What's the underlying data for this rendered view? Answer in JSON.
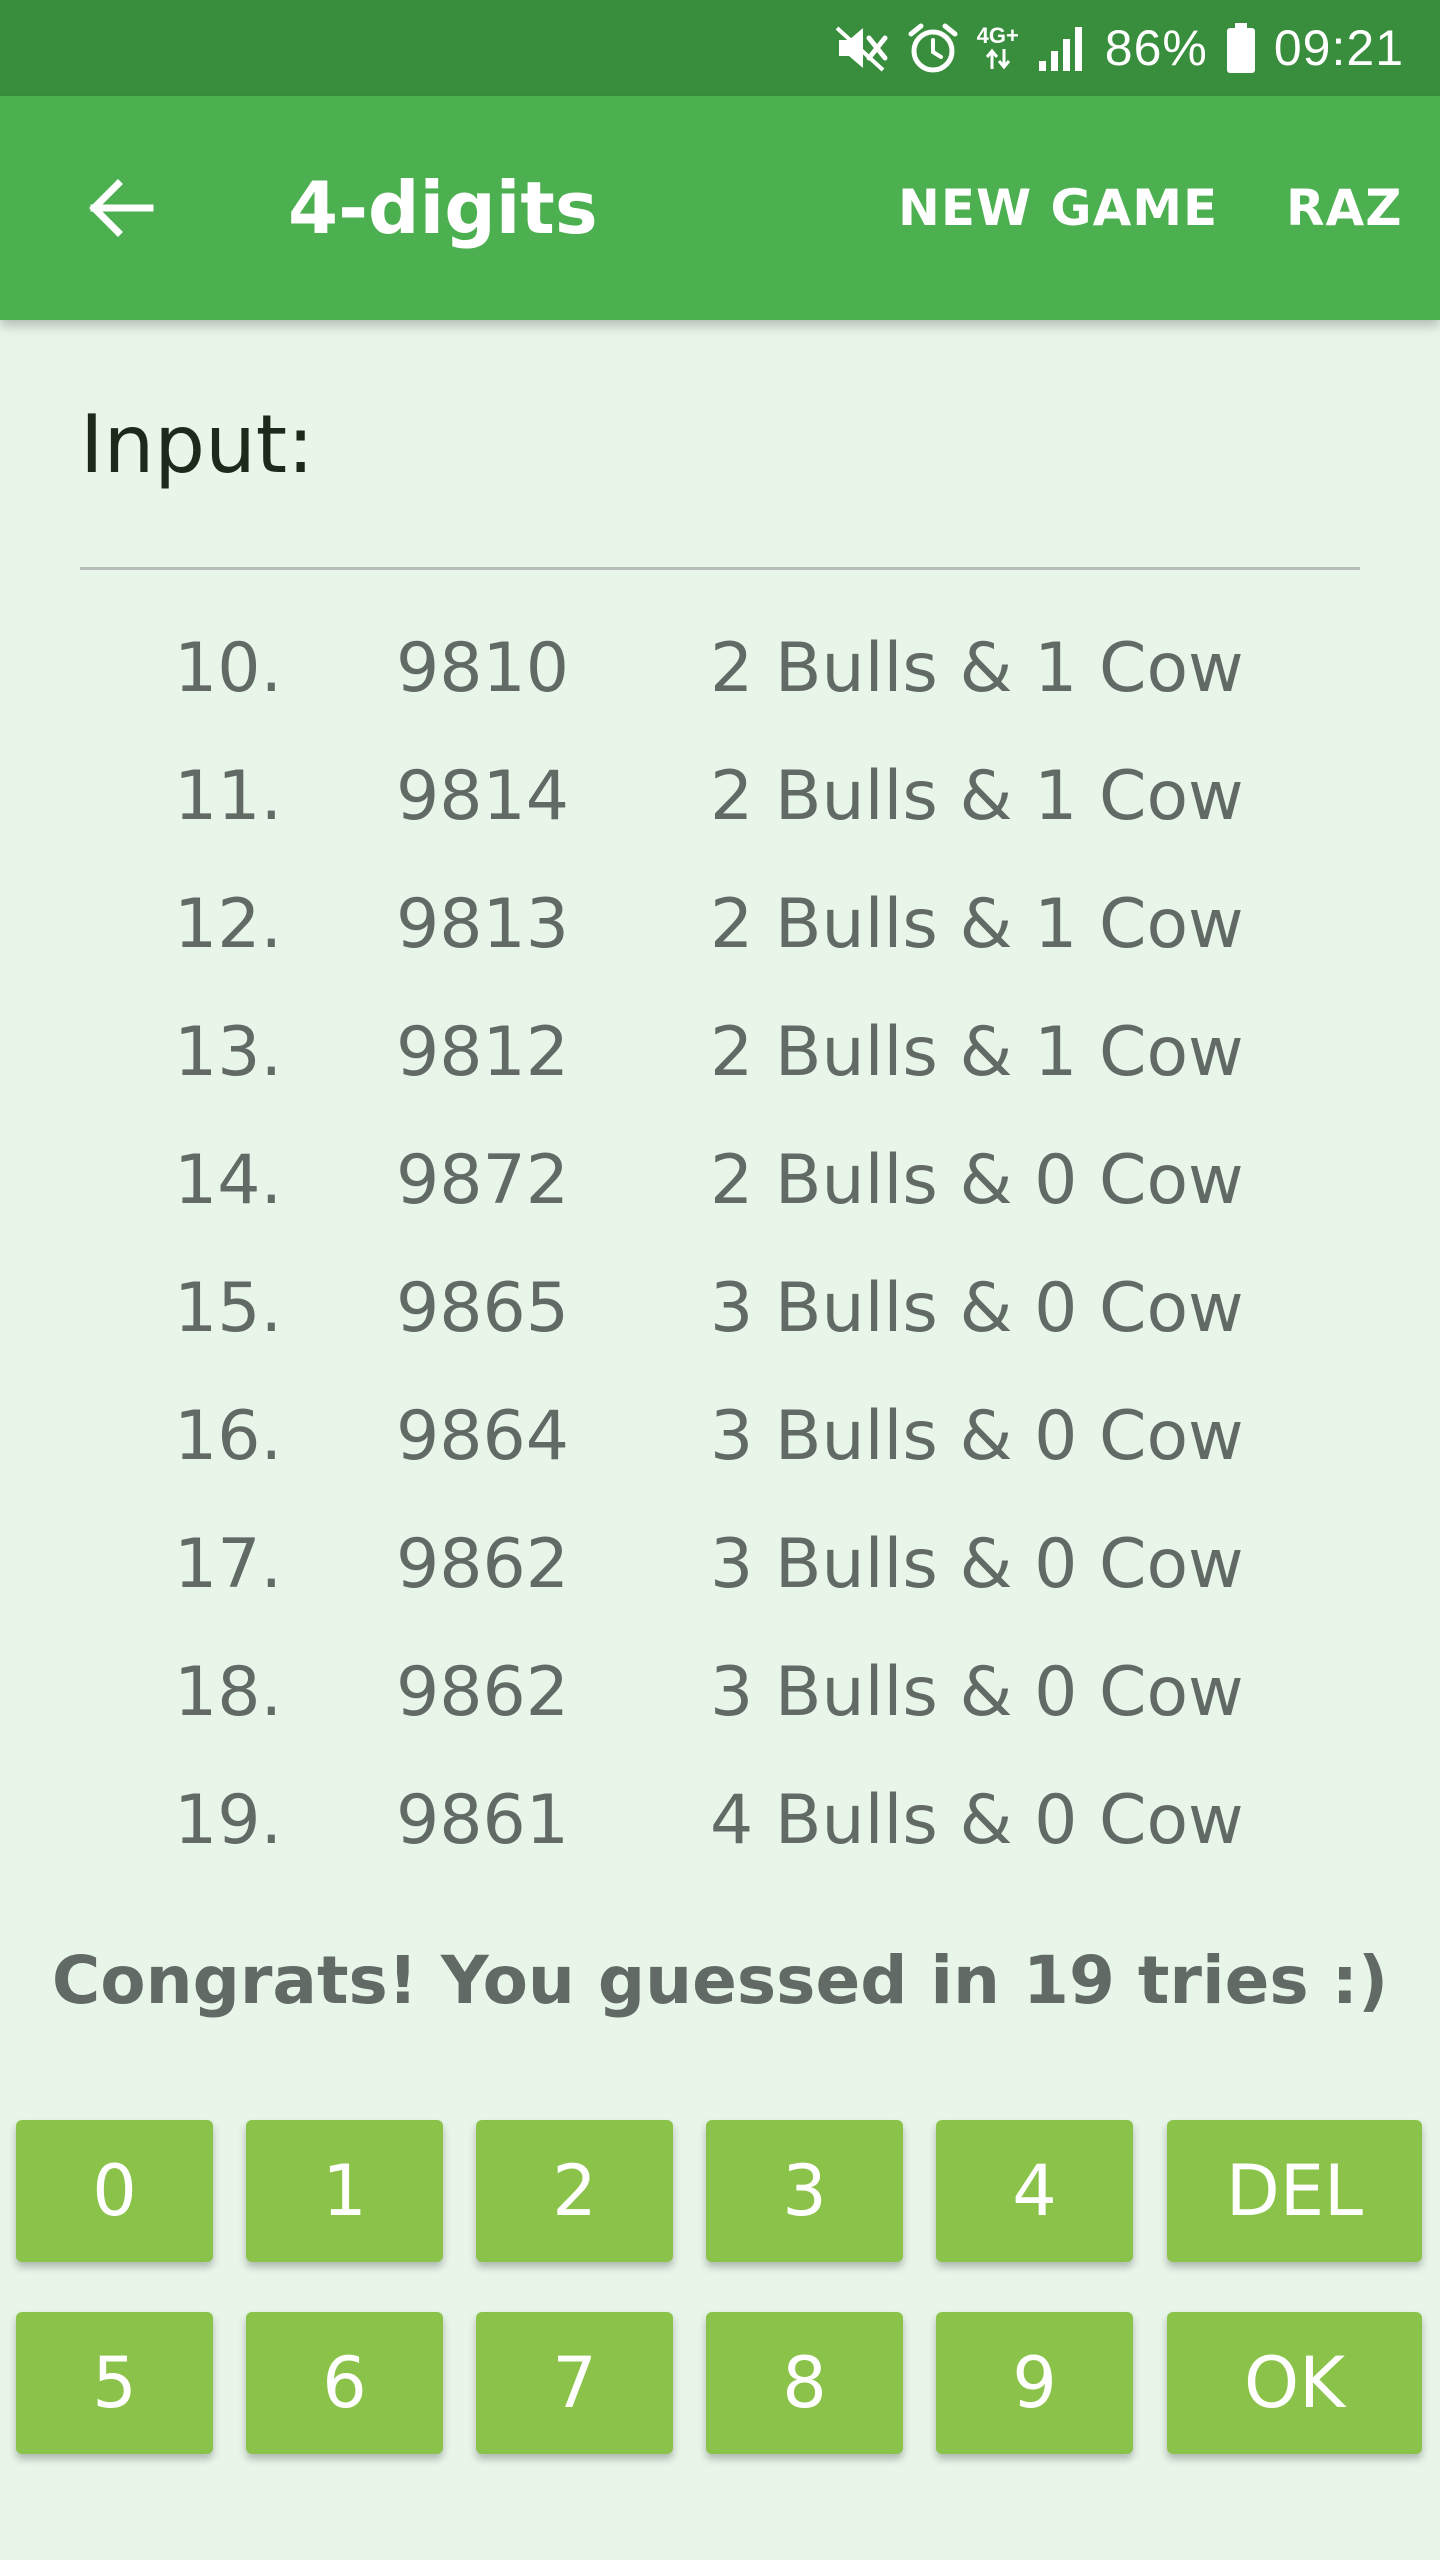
{
  "status_bar": {
    "network": "4G+",
    "battery": "86%",
    "time": "09:21"
  },
  "app_bar": {
    "title": "4-digits",
    "actions": [
      "NEW GAME",
      "RAZ"
    ]
  },
  "input": {
    "label": "Input:"
  },
  "history": [
    {
      "index": "10.",
      "guess": "9810",
      "result": "2 Bulls & 1 Cow"
    },
    {
      "index": "11.",
      "guess": "9814",
      "result": "2 Bulls & 1 Cow"
    },
    {
      "index": "12.",
      "guess": "9813",
      "result": "2 Bulls & 1 Cow"
    },
    {
      "index": "13.",
      "guess": "9812",
      "result": "2 Bulls & 1 Cow"
    },
    {
      "index": "14.",
      "guess": "9872",
      "result": "2 Bulls & 0 Cow"
    },
    {
      "index": "15.",
      "guess": "9865",
      "result": "3 Bulls & 0 Cow"
    },
    {
      "index": "16.",
      "guess": "9864",
      "result": "3 Bulls & 0 Cow"
    },
    {
      "index": "17.",
      "guess": "9862",
      "result": "3 Bulls & 0 Cow"
    },
    {
      "index": "18.",
      "guess": "9862",
      "result": "3 Bulls & 0 Cow"
    },
    {
      "index": "19.",
      "guess": "9861",
      "result": "4 Bulls & 0 Cow"
    }
  ],
  "message": "Congrats! You guessed in 19 tries :)",
  "keypad": {
    "row1": [
      "0",
      "1",
      "2",
      "3",
      "4",
      "DEL"
    ],
    "row2": [
      "5",
      "6",
      "7",
      "8",
      "9",
      "OK"
    ]
  },
  "colors": {
    "status_bar": "#388e3c",
    "app_bar": "#4caf50",
    "background": "#e8f5e9",
    "key": "#8bc34a",
    "text_muted": "#626a66"
  }
}
